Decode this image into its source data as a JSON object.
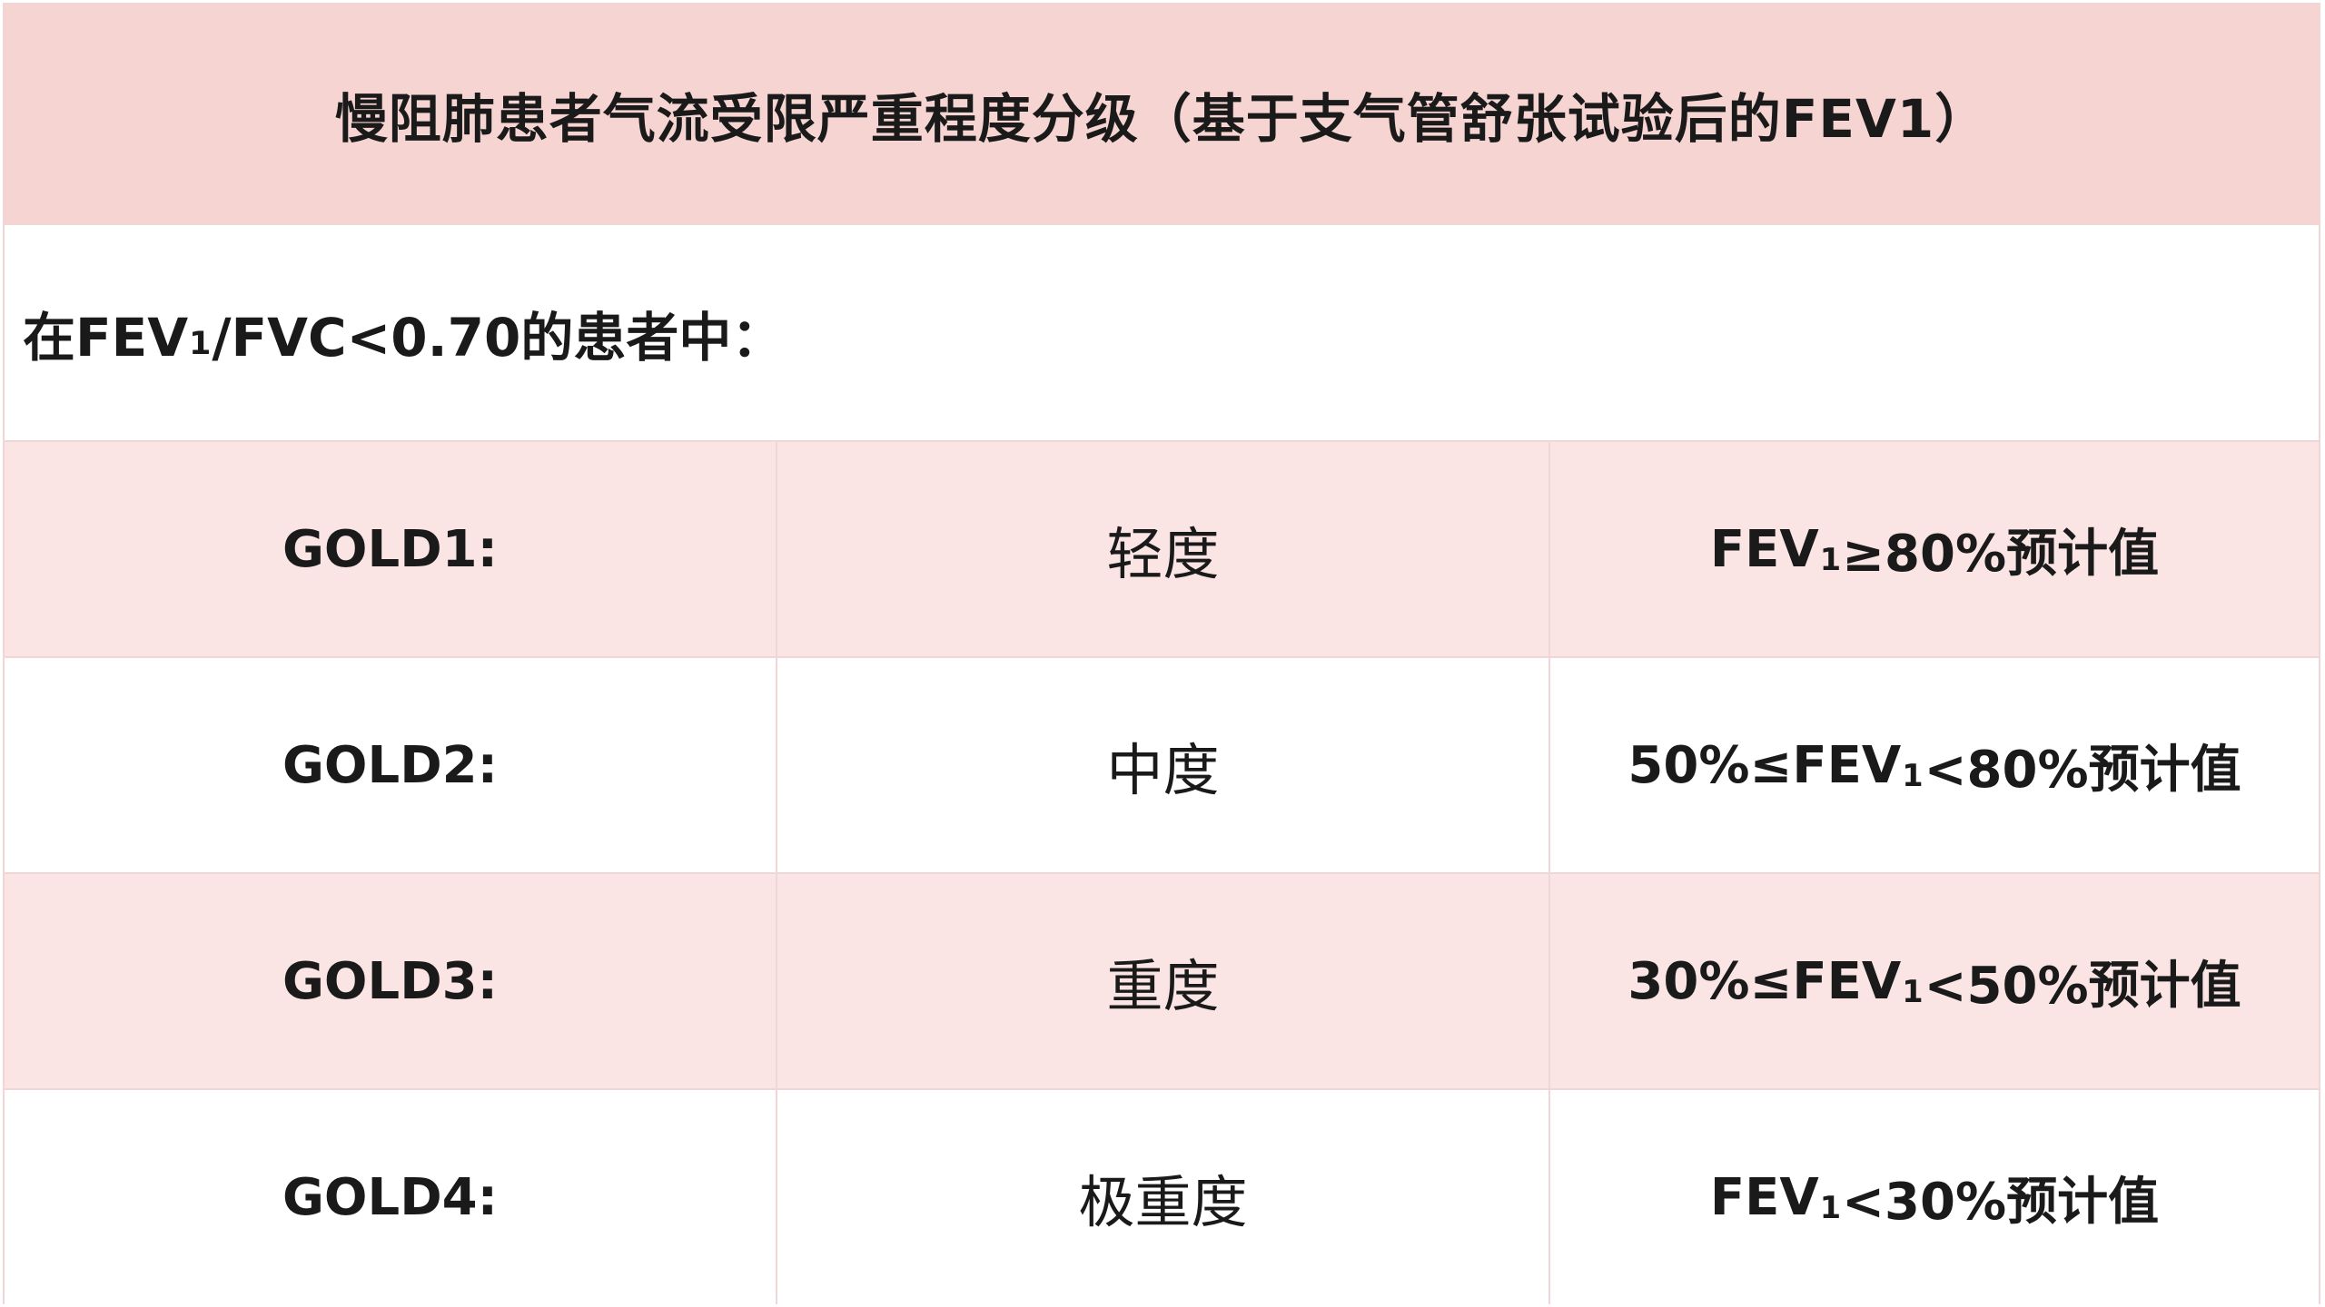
{
  "title": "慢阻肺患者气流受限严重程度分级（基于支气管舒张试验后的FEV1）",
  "subheader": {
    "prefix": "在FEV",
    "sub": "1",
    "suffix": "/FVC<0.70的患者中："
  },
  "rows": [
    {
      "grade": "GOLD1:",
      "severity": "轻度",
      "criterion": {
        "pre": "FEV",
        "sub": "1",
        "post": "≥80%预计值"
      }
    },
    {
      "grade": "GOLD2:",
      "severity": "中度",
      "criterion": {
        "pre": "50%≤FEV",
        "sub": "1",
        "post": "<80%预计值"
      }
    },
    {
      "grade": "GOLD3:",
      "severity": "重度",
      "criterion": {
        "pre": "30%≤FEV",
        "sub": "1",
        "post": "<50%预计值"
      }
    },
    {
      "grade": "GOLD4:",
      "severity": "极重度",
      "criterion": {
        "pre": "FEV",
        "sub": "1",
        "post": "<30%预计值"
      }
    }
  ]
}
